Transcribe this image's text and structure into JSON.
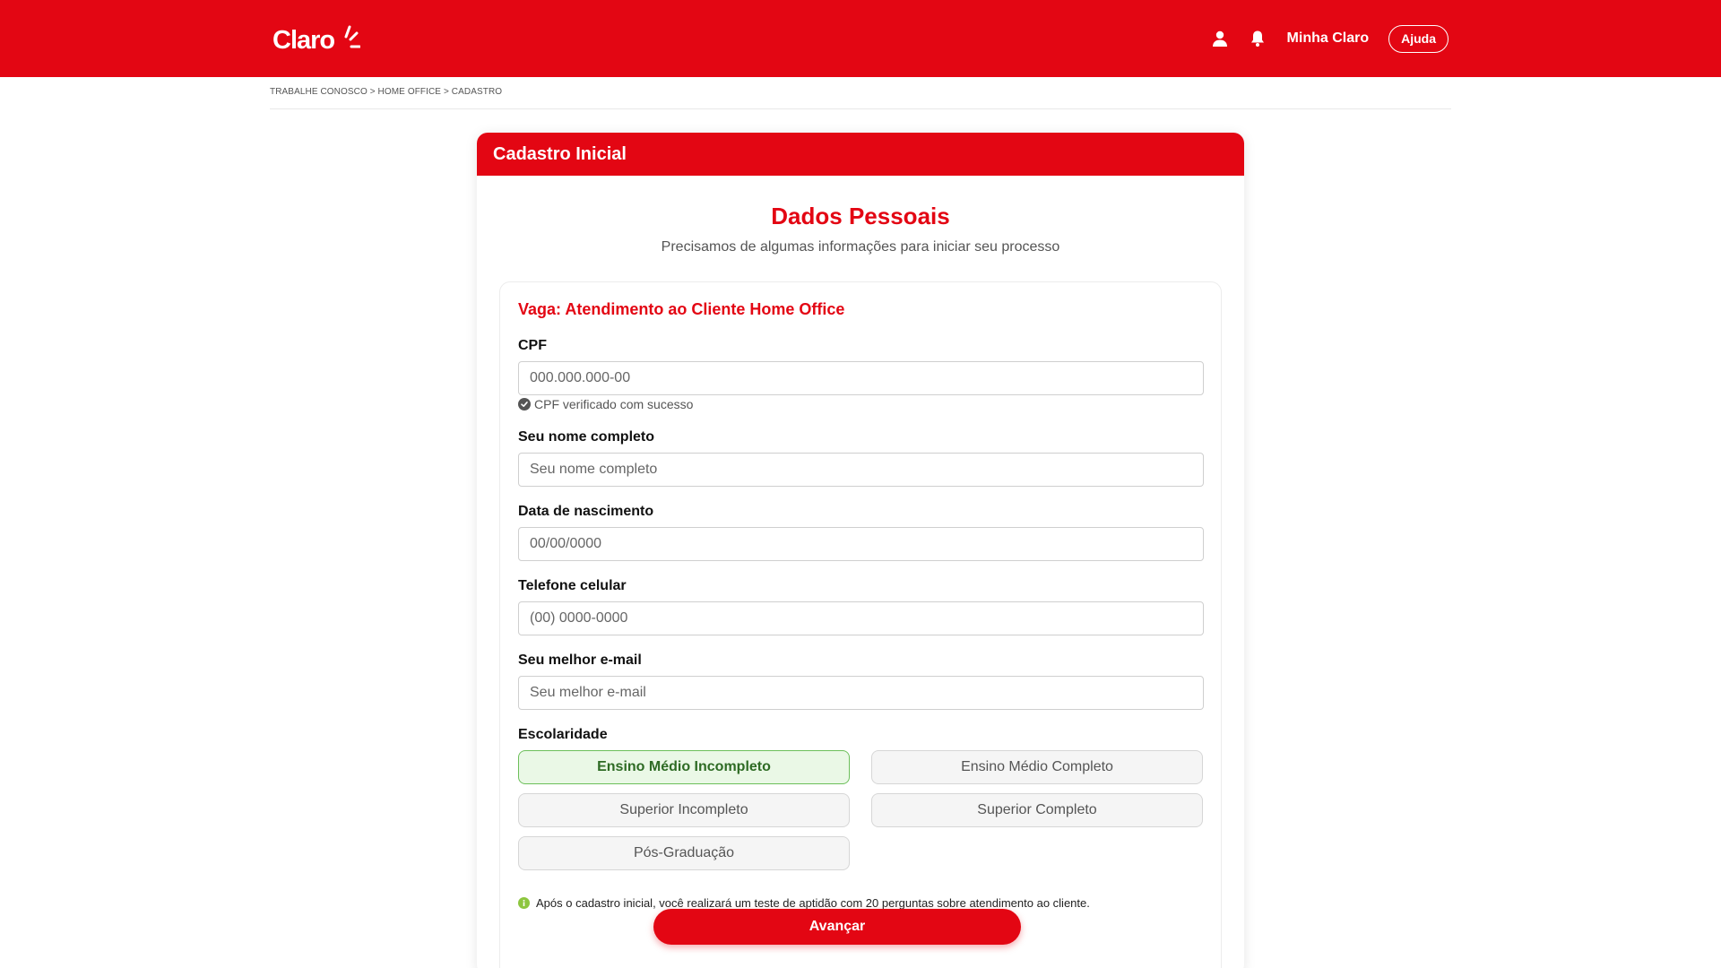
{
  "header": {
    "logo_text": "Claro",
    "user_link": "Minha Claro",
    "help_button": "Ajuda"
  },
  "breadcrumb": "TRABALHE CONOSCO > HOME OFFICE > CADASTRO",
  "card": {
    "title": "Cadastro Inicial",
    "section_title": "Dados Pessoais",
    "section_subtitle": "Precisamos de algumas informações para iniciar seu processo"
  },
  "form": {
    "vaga": "Vaga: Atendimento ao Cliente Home Office",
    "cpf": {
      "label": "CPF",
      "placeholder": "000.000.000-00",
      "status": "CPF verificado com sucesso"
    },
    "name": {
      "label": "Seu nome completo",
      "placeholder": "Seu nome completo"
    },
    "birth": {
      "label": "Data de nascimento",
      "placeholder": "00/00/0000"
    },
    "phone": {
      "label": "Telefone celular",
      "placeholder": "(00) 0000-0000"
    },
    "email": {
      "label": "Seu melhor e-mail",
      "placeholder": "Seu melhor e-mail"
    },
    "education": {
      "label": "Escolaridade",
      "options": [
        "Ensino Médio Incompleto",
        "Ensino Médio Completo",
        "Superior Incompleto",
        "Superior Completo",
        "Pós-Graduação"
      ],
      "selected": "Ensino Médio Incompleto"
    },
    "info_note": "Após o cadastro inicial, você realizará um teste de aptidão com 20 perguntas sobre atendimento ao cliente.",
    "submit_label": "Avançar"
  },
  "colors": {
    "brand_red": "#e30613",
    "selected_green": "#6cbf5a",
    "info_green": "#8dc63f"
  }
}
